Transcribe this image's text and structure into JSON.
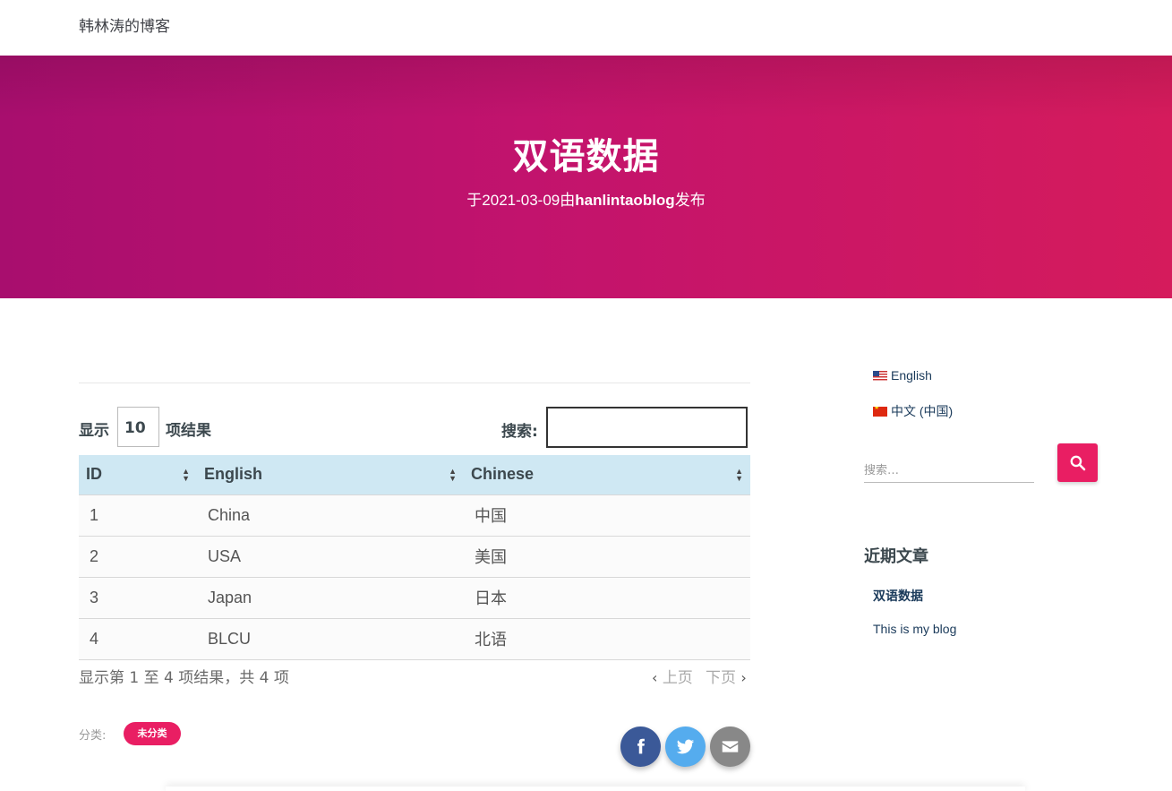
{
  "site": {
    "title": "韩林涛的博客"
  },
  "hero": {
    "title": "双语数据",
    "meta_prefix": "于2021-03-09由",
    "author": "hanlintaoblog",
    "meta_suffix": "发布"
  },
  "table_controls": {
    "length_label": "显示",
    "length_value": "10",
    "length_suffix": "项结果",
    "search_label": "搜索:"
  },
  "table": {
    "headers": [
      "ID",
      "English",
      "Chinese"
    ],
    "rows": [
      [
        "1",
        "China",
        "中国"
      ],
      [
        "2",
        "USA",
        "美国"
      ],
      [
        "3",
        "Japan",
        "日本"
      ],
      [
        "4",
        "BLCU",
        "北语"
      ]
    ],
    "info": "显示第 1 至 4 项结果，共 4 项",
    "prev_label": "上页",
    "next_label": "下页"
  },
  "post_footer": {
    "category_label": "分类:",
    "category": "未分类"
  },
  "sidebar": {
    "languages": [
      "English",
      "中文 (中国)"
    ],
    "search_placeholder": "搜索…",
    "recent_title": "近期文章",
    "recent_posts": [
      "双语数据",
      "This is my blog"
    ]
  },
  "colors": {
    "accent": "#e91e63",
    "hero_start": "#a80e6e",
    "hero_end": "#d51b5c",
    "table_header": "#cfe8f3",
    "facebook": "#3b5998",
    "twitter": "#55acee",
    "email": "#888888"
  },
  "icons": [
    "facebook-icon",
    "twitter-icon",
    "email-icon",
    "search-icon",
    "sort-icon",
    "chevron-left-icon",
    "chevron-right-icon",
    "us-flag-icon",
    "cn-flag-icon"
  ]
}
